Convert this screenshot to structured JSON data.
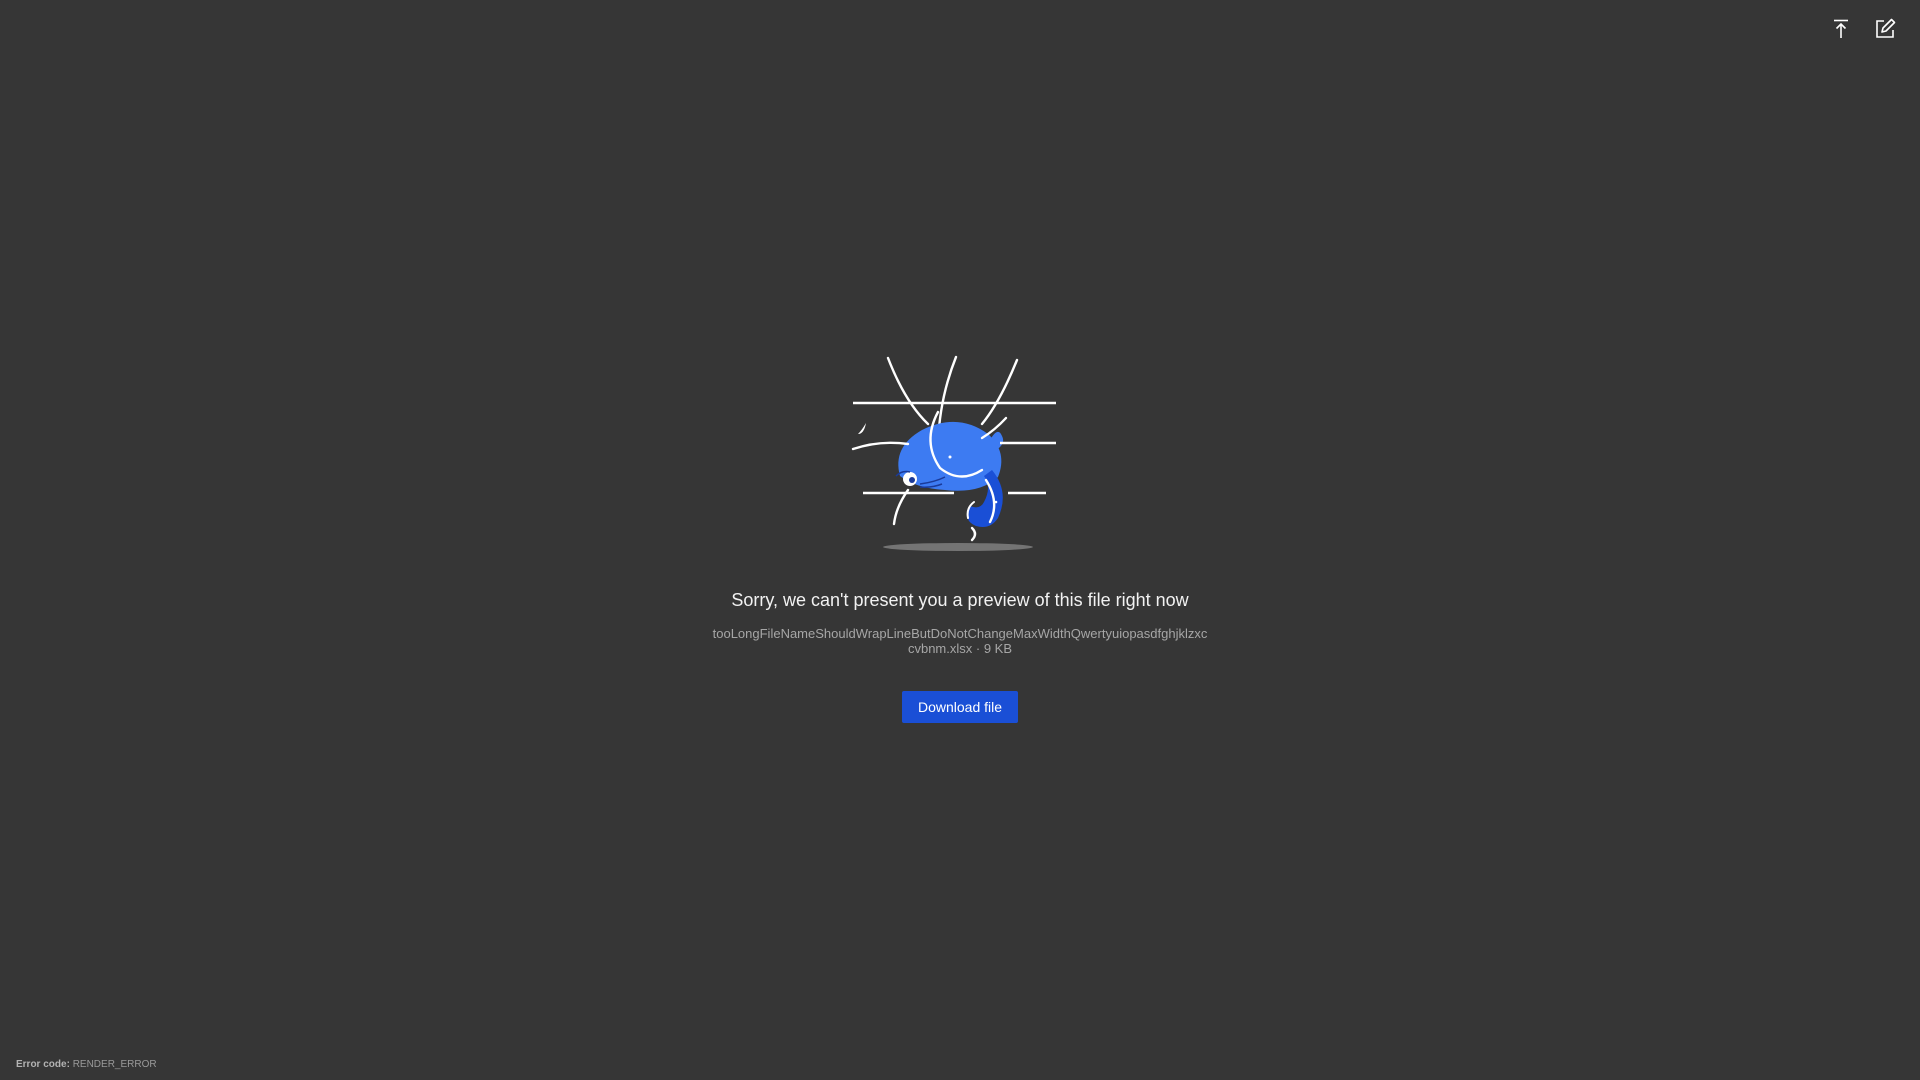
{
  "toolbar": {
    "upload_icon": "arrow-up-to-line-icon",
    "edit_icon": "pencil-square-icon"
  },
  "preview": {
    "message": "Sorry, we can't present you a preview of this file right now",
    "file_name": "tooLongFileNameShouldWrapLineButDoNotChangeMaxWidthQwertyuiopasdfghjklzxccvbnm.xlsx",
    "separator": " · ",
    "file_size": "9 KB",
    "download_label": "Download file"
  },
  "footer": {
    "error_label": "Error code:",
    "error_value": "RENDER_ERROR"
  },
  "colors": {
    "background": "#363636",
    "accent": "#1a4fd6",
    "illustration_blue": "#3d7bf2"
  }
}
